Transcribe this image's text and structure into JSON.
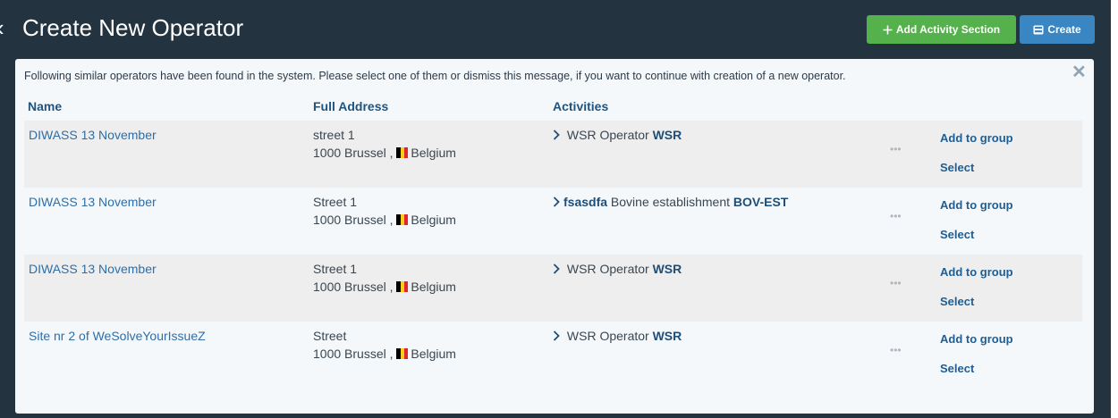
{
  "header": {
    "title": "Create New Operator",
    "add_activity_label": "Add Activity Section",
    "create_label": "Create"
  },
  "colors": {
    "header_bg": "#233340",
    "add_button": "#55b14b",
    "create_button": "#3a86c2",
    "link": "#2e6ea8",
    "flag_belgium": [
      "#000000",
      "#f6cd1b",
      "#e2262f"
    ]
  },
  "notice": {
    "message": "Following similar operators have been found in the system. Please select one of them or dismiss this message, if you want to continue with creation of a new operator."
  },
  "columns": {
    "name": "Name",
    "address": "Full Address",
    "activities": "Activities"
  },
  "rows": [
    {
      "name": "DIWASS 13 November",
      "street": "street 1",
      "city": "1000 Brussel ,",
      "country": "Belgium",
      "act_prefix": "",
      "act_text": "WSR Operator",
      "act_code": "WSR",
      "more": "•••",
      "add_to_group": "Add to group",
      "select": "Select"
    },
    {
      "name": "DIWASS 13 November",
      "street": "Street 1",
      "city": "1000 Brussel ,",
      "country": "Belgium",
      "act_prefix": "fsasdfa",
      "act_text": "Bovine establishment",
      "act_code": "BOV-EST",
      "more": "•••",
      "add_to_group": "Add to group",
      "select": "Select"
    },
    {
      "name": "DIWASS 13 November",
      "street": "Street 1",
      "city": "1000 Brussel ,",
      "country": "Belgium",
      "act_prefix": "",
      "act_text": "WSR Operator",
      "act_code": "WSR",
      "more": "•••",
      "add_to_group": "Add to group",
      "select": "Select"
    },
    {
      "name": "Site nr 2 of WeSolveYourIssueZ",
      "street": "Street",
      "city": "1000 Brussel ,",
      "country": "Belgium",
      "act_prefix": "",
      "act_text": "WSR Operator",
      "act_code": "WSR",
      "more": "•••",
      "add_to_group": "Add to group",
      "select": "Select"
    }
  ]
}
